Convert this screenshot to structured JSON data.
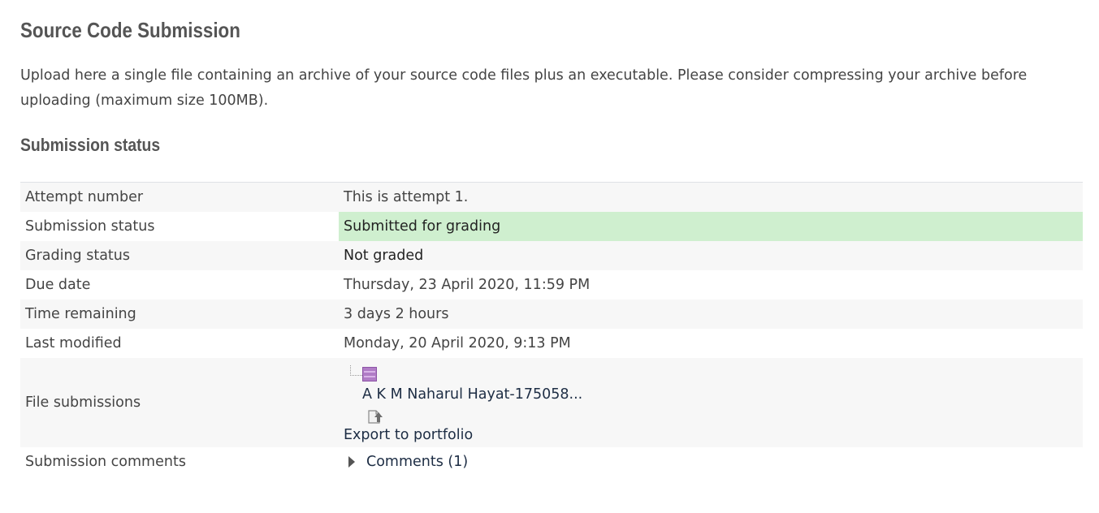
{
  "page": {
    "title": "Source Code Submission",
    "intro": "Upload here a single file containing an archive of your source code files plus an executable. Please consider compressing your archive before uploading (maximum size 100MB)."
  },
  "status": {
    "heading": "Submission status",
    "rows": {
      "attempt": {
        "label": "Attempt number",
        "value": "This is attempt 1."
      },
      "submission": {
        "label": "Submission status",
        "value": "Submitted for grading"
      },
      "grading": {
        "label": "Grading status",
        "value": "Not graded"
      },
      "due": {
        "label": "Due date",
        "value": "Thursday, 23 April 2020, 11:59 PM"
      },
      "remaining": {
        "label": "Time remaining",
        "value": "3 days 2 hours"
      },
      "modified": {
        "label": "Last modified",
        "value": "Monday, 20 April 2020, 9:13 PM"
      },
      "files": {
        "label": "File submissions",
        "file_name": "A K M Naharul Hayat-175058...",
        "file_icon": "archive-icon",
        "export_icon": "portfolio-export-icon",
        "export_label": "Export to portfolio"
      },
      "comments": {
        "label": "Submission comments",
        "value": "Comments (1)",
        "icon": "caret-right-icon"
      }
    }
  },
  "colors": {
    "submitted_bg": "#cfefcf",
    "row_alt_bg": "#f7f7f7",
    "heading": "#555555",
    "link": "#1d2d44"
  }
}
